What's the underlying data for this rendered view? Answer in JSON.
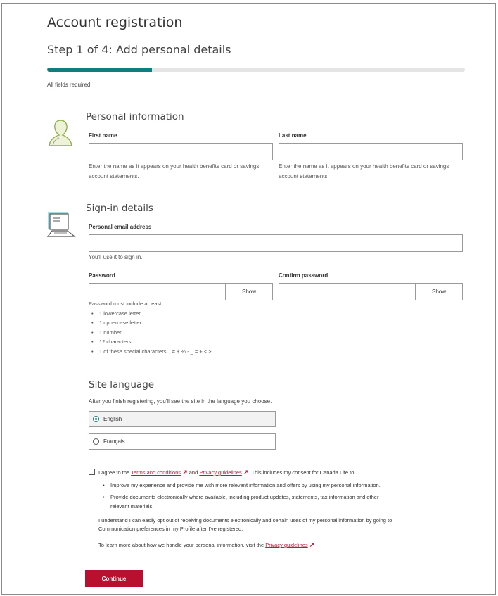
{
  "header": {
    "title": "Account registration",
    "step": "Step 1 of 4: Add personal details",
    "progress_fraction": 0.25,
    "fields_note": "All fields required"
  },
  "personal": {
    "heading": "Personal information",
    "first_name_label": "First name",
    "first_name_value": "",
    "last_name_label": "Last name",
    "last_name_value": "",
    "first_hint_1": "Enter the name as it appears on your health benefits card or savings",
    "first_hint_2": "account statements.",
    "last_hint_1": "Enter the name as it appears on your health benefits card or savings",
    "last_hint_2": "account statements."
  },
  "signin": {
    "heading": "Sign-in details",
    "email_label": "Personal email address",
    "email_value": "",
    "email_hint": "You'll use it to sign in.",
    "password_label": "Password",
    "confirm_label": "Confirm password",
    "show_label": "Show",
    "rules_title": "Password must include at least:",
    "rules": [
      "1 lowercase letter",
      "1 uppercase letter",
      "1 number",
      "12 characters",
      "1 of these special characters: ! # $ % - _ = + < >"
    ]
  },
  "language": {
    "heading": "Site language",
    "note": "After you finish registering, you'll see the site in the language you choose.",
    "options": [
      "English",
      "Français"
    ],
    "selected": "English"
  },
  "consent": {
    "prefix": "I agree to the ",
    "terms_link": "Terms and conditions",
    "and": " and ",
    "privacy_link": "Privacy guidelines",
    "suffix": ". This includes my consent for Canada Life to:",
    "bullet_1": "Improve my experience and provide me with more relevant information and offers by using my personal information.",
    "bullet_2a": "Provide documents electronically where available, including product updates, statements, tax information and other",
    "bullet_2b": "relevant materials.",
    "optout_1": "I understand I can easily opt out of receiving documents electronically and certain uses of my personal information by going to",
    "optout_2": "Communication preferences in my Profile after I've registered.",
    "learn_prefix": "To learn more about how we handle your personal information, visit the ",
    "learn_link": "Privacy guidelines",
    "learn_suffix": " ."
  },
  "continue_label": "Continue",
  "colors": {
    "accent": "#0d7f80",
    "brand": "#b8102e",
    "link": "#b71c3a"
  }
}
